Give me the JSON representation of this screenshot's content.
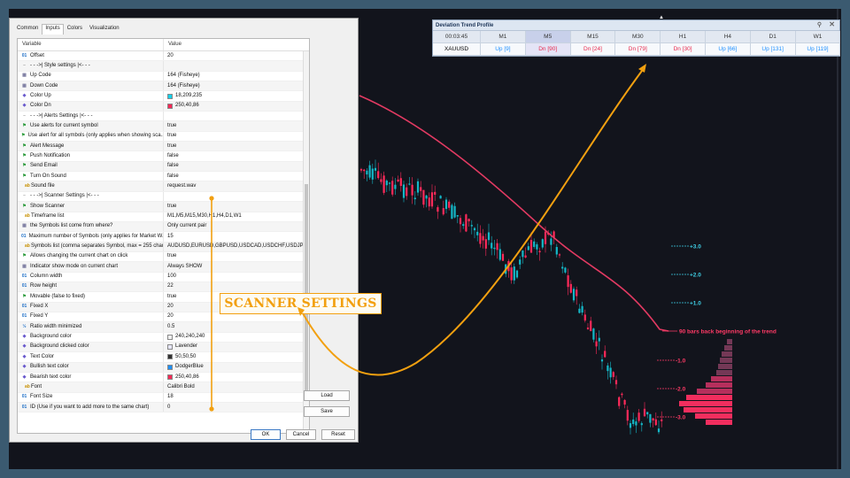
{
  "dialog": {
    "tabs": [
      "Common",
      "Inputs",
      "Colors",
      "Visualization"
    ],
    "active_tab": "Inputs",
    "columns": [
      "Variable",
      "Value"
    ],
    "rows": [
      {
        "icon": "01",
        "type": "t01",
        "name": "Offset",
        "value": "20"
      },
      {
        "icon": "–",
        "type": "tsep",
        "name": "- - ->| Style settings |<- - -",
        "value": ""
      },
      {
        "icon": "▦",
        "type": "tgrid",
        "name": "Up Code",
        "value": "164 (Fisheye)"
      },
      {
        "icon": "▦",
        "type": "tgrid",
        "name": "Down Code",
        "value": "164 (Fisheye)"
      },
      {
        "icon": "◆",
        "type": "tcolor",
        "name": "Color Up",
        "value": "18,209,235",
        "swatch": "#12d1eb"
      },
      {
        "icon": "◆",
        "type": "tcolor",
        "name": "Color Dn",
        "value": "250,40,86",
        "swatch": "#fa2856"
      },
      {
        "icon": "–",
        "type": "tsep",
        "name": "- - ->| Alerts Settings |<- - -",
        "value": ""
      },
      {
        "icon": "⚑",
        "type": "tflag",
        "name": "Use alerts for current symbol",
        "value": "true"
      },
      {
        "icon": "⚑",
        "type": "tflag",
        "name": "Use alert for all symbols (only applies when showing sca...",
        "value": "true"
      },
      {
        "icon": "⚑",
        "type": "tflag",
        "name": "Alert Message",
        "value": "true"
      },
      {
        "icon": "⚑",
        "type": "tflag",
        "name": "Push Notification",
        "value": "false"
      },
      {
        "icon": "⚑",
        "type": "tflag",
        "name": "Send Email",
        "value": "false"
      },
      {
        "icon": "⚑",
        "type": "tflag",
        "name": "Turn On Sound",
        "value": "false"
      },
      {
        "icon": "ab",
        "type": "tab",
        "name": "Sound file",
        "value": "request.wav"
      },
      {
        "icon": "–",
        "type": "tsep",
        "name": "- - ->| Scanner Settings |<- - -",
        "value": ""
      },
      {
        "icon": "⚑",
        "type": "tflag",
        "name": "Show Scanner",
        "value": "true"
      },
      {
        "icon": "ab",
        "type": "tab",
        "name": "Timeframe list",
        "value": "M1,M5,M15,M30,H1,H4,D1,W1"
      },
      {
        "icon": "▦",
        "type": "tgrid",
        "name": "the Symbols list come from where?",
        "value": "Only current pair"
      },
      {
        "icon": "01",
        "type": "t01",
        "name": "Maximum number of Symbols (only applies for Market W...",
        "value": "15"
      },
      {
        "icon": "ab",
        "type": "tab",
        "name": "Symbols list (comma separates Symbol, max = 255 char...",
        "value": "AUDUSD,EURUSD,GBPUSD,USDCAD,USDCHF,USDJPY,NZD..."
      },
      {
        "icon": "⚑",
        "type": "tflag",
        "name": "Allows changing the current chart on click",
        "value": "true"
      },
      {
        "icon": "▦",
        "type": "tgrid",
        "name": "Indicator show mode on current chart",
        "value": "Always SHOW"
      },
      {
        "icon": "01",
        "type": "t01",
        "name": "Column width",
        "value": "100"
      },
      {
        "icon": "01",
        "type": "t01",
        "name": "Row height",
        "value": "22"
      },
      {
        "icon": "⚑",
        "type": "tflag",
        "name": "Movable (false to fixed)",
        "value": "true"
      },
      {
        "icon": "01",
        "type": "t01",
        "name": "Fixed X",
        "value": "20"
      },
      {
        "icon": "01",
        "type": "t01",
        "name": "Fixed Y",
        "value": "20"
      },
      {
        "icon": "½",
        "type": "thalf",
        "name": "Ratio width minimized",
        "value": "0.5"
      },
      {
        "icon": "◆",
        "type": "tcolor",
        "name": "Background color",
        "value": "240,240,240",
        "swatch": "#f0f0f0"
      },
      {
        "icon": "◆",
        "type": "tcolor",
        "name": "Background clicked color",
        "value": "Lavender",
        "swatch": "#e6e6fa"
      },
      {
        "icon": "◆",
        "type": "tcolor",
        "name": "Text Color",
        "value": "50,50,50",
        "swatch": "#323232"
      },
      {
        "icon": "◆",
        "type": "tcolor",
        "name": "Bullish text color",
        "value": "DodgerBlue",
        "swatch": "#1e90ff"
      },
      {
        "icon": "◆",
        "type": "tcolor",
        "name": "Bearish text color",
        "value": "250,40,86",
        "swatch": "#fa2856"
      },
      {
        "icon": "ab",
        "type": "tab",
        "name": "Font",
        "value": "Calibri Bold"
      },
      {
        "icon": "01",
        "type": "t01",
        "name": "Font Size",
        "value": "18"
      },
      {
        "icon": "01",
        "type": "t01",
        "name": "ID (Use if you want to add more to the same chart)",
        "value": "0"
      }
    ],
    "buttons": {
      "load": "Load",
      "save": "Save",
      "ok": "OK",
      "cancel": "Cancel",
      "reset": "Reset"
    }
  },
  "profile_panel": {
    "title": "Deviation Trend Profile",
    "timer": "00:03:45",
    "symbol": "XAUUSD",
    "timeframes": [
      "M1",
      "M5",
      "M15",
      "M30",
      "H1",
      "H4",
      "D1",
      "W1"
    ],
    "values": [
      "Up [9]",
      "Dn [90]",
      "Dn [24]",
      "Dn [79]",
      "Dn [30]",
      "Up [66]",
      "Up [131]",
      "Up [119]"
    ],
    "directions": [
      "up",
      "dn",
      "dn",
      "dn",
      "dn",
      "up",
      "up",
      "up"
    ],
    "highlighted": "M5",
    "pin_icon": "pin-icon",
    "close_icon": "close-icon"
  },
  "callout": {
    "text": "SCANNER SETTINGS",
    "color": "#f2a010"
  },
  "chart": {
    "trend_label": "90 bars back beginning of the trend",
    "levels": [
      "+3.0",
      "+2.0",
      "+1.0",
      "-1.0",
      "-2.0",
      "-3.0"
    ],
    "bull_color": "#14b8c8",
    "bear_color": "#ff2a5a",
    "trend_line_color": "#e23a62"
  },
  "colors": {
    "accent": "#f2a010",
    "chart_bg": "#12141c",
    "dialog_bg": "#f0f0f0"
  }
}
